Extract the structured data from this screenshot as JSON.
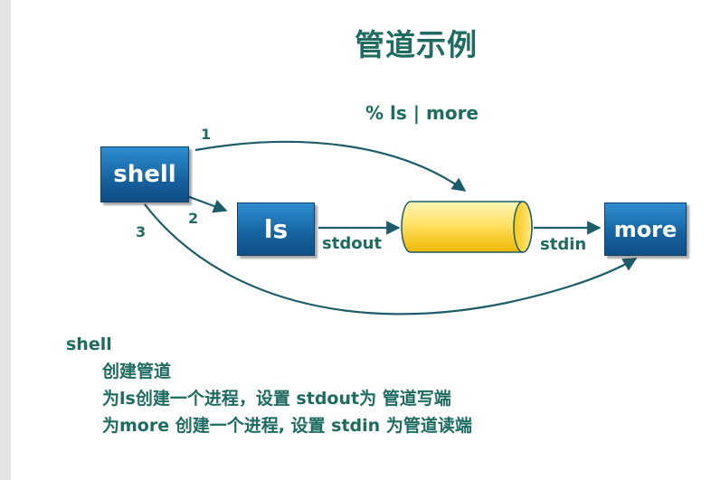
{
  "title": "管道示例",
  "command": "% ls | more",
  "boxes": {
    "shell": "shell",
    "ls": "ls",
    "more": "more"
  },
  "arrow_labels": {
    "one": "1",
    "two": "2",
    "three": "3",
    "stdout": "stdout",
    "stdin": "stdin"
  },
  "notes": {
    "heading": "shell",
    "lines": [
      "创建管道",
      "为ls创建一个进程，设置 stdout为 管道写端",
      "为more 创建一个进程, 设置 stdin 为管道读端"
    ]
  },
  "colors": {
    "text": "#1d6b61",
    "box": "#16629f",
    "pipe": "#ffd84a",
    "arrow": "#1d5c6a"
  }
}
